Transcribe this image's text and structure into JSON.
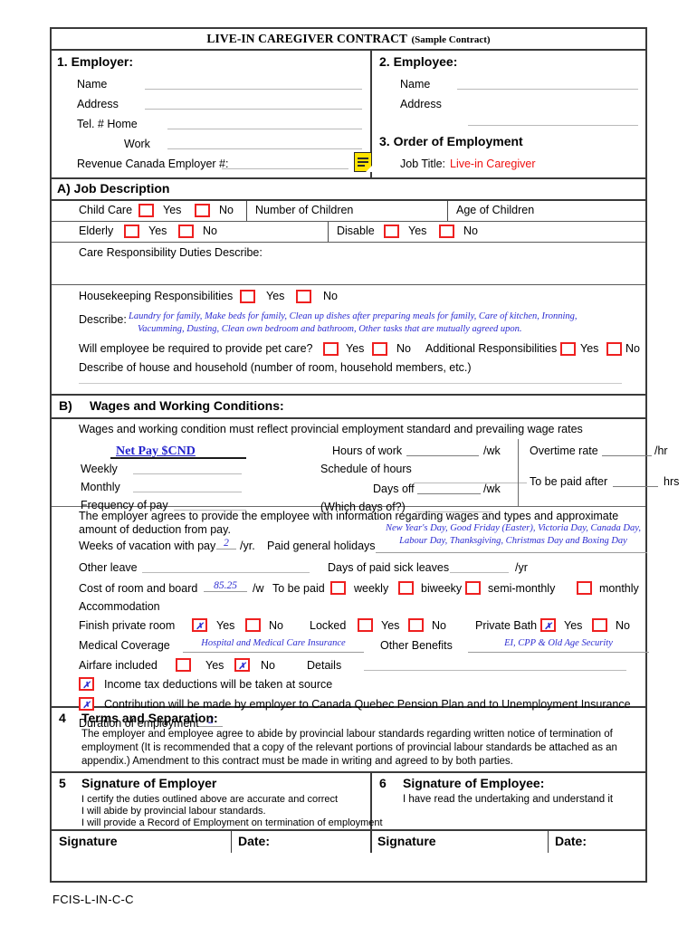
{
  "document": {
    "title_main": "LIVE-IN CAREGIVER CONTRACT",
    "title_sub": "(Sample Contract)",
    "footer_code": "FCIS-L-IN-C-C"
  },
  "employer": {
    "heading": "1. Employer:",
    "name_label": "Name",
    "address_label": "Address",
    "tel_home_label": "Tel. # Home",
    "work_label": "Work",
    "revenue_label": "Revenue Canada Employer #:",
    "note_icon": "sticky-note-icon"
  },
  "employee": {
    "heading": "2. Employee:",
    "name_label": "Name",
    "address_label": "Address"
  },
  "order_of_employment": {
    "heading": "3. Order of Employment",
    "job_title_label": "Job Title:",
    "job_title_value": "Live-in Caregiver",
    "job_title_color": "#ee1111"
  },
  "job_description": {
    "heading": "A) Job Description",
    "child_care_label": "Child Care",
    "yes_label": "Yes",
    "no_label": "No",
    "number_of_children_label": "Number of Children",
    "age_of_children_label": "Age of Children",
    "elderly_label": "Elderly",
    "disable_label": "Disable",
    "care_duties_label": "Care Responsibility Duties Describe:",
    "housekeeping_label": "Housekeeping Responsibilities",
    "describe_label": "Describe:",
    "describe_line1": "Laundry for family, Make beds for family, Clean up dishes after preparing meals for family, Care of kitchen, Ironning,",
    "describe_line2": "Vacumming, Dusting,  Clean own bedroom and bathroom, Other tasks that are mutually agreed upon.",
    "pet_care_label": "Will employee be required to provide pet care?",
    "additional_resp_label": "Additional Responsibilities",
    "house_describe_label": "Describe of house and household (number of room, household members, etc.)"
  },
  "wages": {
    "heading": "B)",
    "heading_text": "Wages and Working Conditions:",
    "intro": "Wages and working condition must reflect provincial employment standard and prevailing wage rates",
    "net_pay_label": "Net Pay $CND",
    "weekly_label": "Weekly",
    "monthly_label": "Monthly",
    "frequency_label": "Frequency of pay",
    "hours_of_work_label": "Hours of work",
    "per_wk": "/wk",
    "schedule_label": "Schedule of hours",
    "days_off_label": "Days off",
    "which_days_label": "(Which days of?)",
    "overtime_label": "Overtime rate",
    "per_hr": "/hr",
    "to_be_paid_after_label": "To be paid after",
    "hrs_label": "hrs"
  },
  "deductions": {
    "intro_line1": "The employer agrees to provide the employee with information regarding wages and types and approximate",
    "intro_line2": "amount of deduction from pay.",
    "vacation_label": "Weeks of vacation with pay",
    "vacation_value": "2",
    "per_yr_dot": "/yr.",
    "holidays_label": "Paid general holidays",
    "holidays_line1": "New Year's Day, Good Friday (Easter), Victoria Day, Canada Day,",
    "holidays_line2": "Labour Day, Thanksgiving, Christmas Day and Boxing Day",
    "other_leave_label": "Other leave",
    "sick_leave_label": "Days of paid sick leaves",
    "per_yr": "/yr",
    "room_board_label": "Cost of room and board",
    "room_board_value": "85.25",
    "per_w": "/w",
    "to_be_paid_label": "To be paid",
    "weekly_opt": "weekly",
    "biweekly_opt": "biweeky",
    "semimonthly_opt": "semi-monthly",
    "monthly_opt": "monthly",
    "accommodation_label": "Accommodation",
    "finish_private_room_label": "Finish private room",
    "finish_private_room_yes_checked": true,
    "finish_private_room_no_checked": false,
    "locked_label": "Locked",
    "locked_yes_checked": false,
    "locked_no_checked": false,
    "private_bath_label": "Private Bath",
    "private_bath_yes_checked": true,
    "private_bath_no_checked": false,
    "medical_coverage_label": "Medical Coverage",
    "medical_coverage_value": "Hospital and Medical Care Insurance",
    "other_benefits_label": "Other Benefits",
    "other_benefits_value": "EI, CPP & Old Age Security",
    "airfare_label": "Airfare included",
    "airfare_yes_checked": false,
    "airfare_no_checked": true,
    "details_label": "Details",
    "income_tax_label": "Income tax deductions will be taken at source",
    "income_tax_checked": true,
    "contribution_label": "Contribution will be made by employer to Canada Quebec Pension Plan and to Unemployment Insurance",
    "contribution_checked": true,
    "duration_label": "Duration of employment",
    "duration_value": "2",
    "yes_label": "Yes",
    "no_label": "No",
    "x_mark": "✗"
  },
  "terms": {
    "number": "4",
    "heading": "Terms and Separation:",
    "line1": "The employer and employee agree to abide by provincial labour standards regarding written notice of termination of",
    "line2": "employment (It is recommended that a copy of the relevant portions of provincial labour standards be attached as an",
    "line3": "appendix.) Amendment to this contract must be made in writing and agreed to by both parties."
  },
  "signatures": {
    "employer_number": "5",
    "employer_heading": "Signature of Employer",
    "employer_line1": "I certify the duties outlined above are accurate and correct",
    "employer_line2": "I will abide by provincial labour standards.",
    "employer_line3": "I will provide a Record of Employment on termination of employment",
    "employee_number": "6",
    "employee_heading": "Signature of Employee:",
    "employee_line1": "I have read the undertaking and understand it",
    "signature_label_1": "Signature",
    "date_label_1": "Date:",
    "signature_label_2": "Signature",
    "date_label_2": "Date:"
  }
}
